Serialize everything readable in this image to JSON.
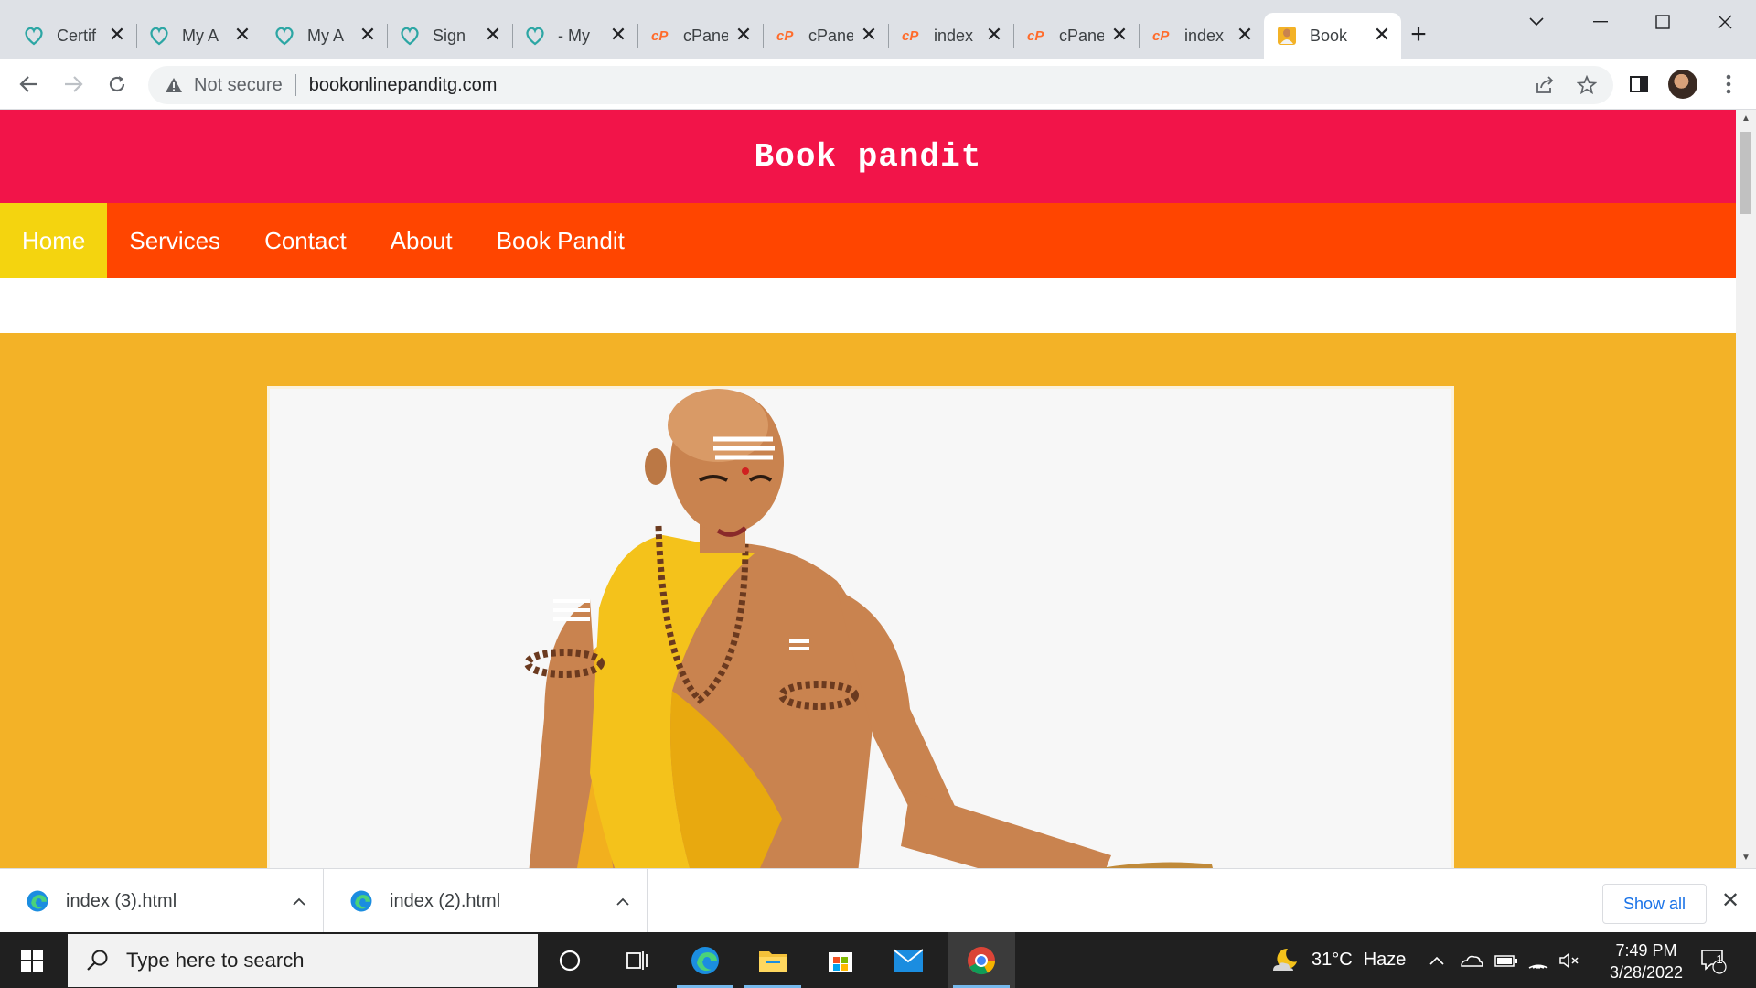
{
  "browser": {
    "tabs": [
      {
        "title": "Certif",
        "icon": "heart-logo-icon",
        "active": false
      },
      {
        "title": "My A",
        "icon": "heart-logo-icon",
        "active": false
      },
      {
        "title": "My A",
        "icon": "heart-logo-icon",
        "active": false
      },
      {
        "title": "Sign",
        "icon": "heart-logo-icon",
        "active": false
      },
      {
        "title": "- My",
        "icon": "heart-logo-icon",
        "active": false
      },
      {
        "title": "cPane",
        "icon": "cpanel-icon",
        "active": false
      },
      {
        "title": "cPane",
        "icon": "cpanel-icon",
        "active": false
      },
      {
        "title": "index",
        "icon": "cpanel-icon",
        "active": false
      },
      {
        "title": "cPane",
        "icon": "cpanel-icon",
        "active": false
      },
      {
        "title": "index",
        "icon": "cpanel-icon",
        "active": false
      },
      {
        "title": "Book",
        "icon": "site-favicon",
        "active": true
      }
    ],
    "close_glyph": "✕",
    "newtab_glyph": "+",
    "security_label": "Not secure",
    "url": "bookonlinepanditg.com",
    "colors": {
      "tabstrip": "#dee1e6",
      "toolbar": "#ffffff",
      "omnibox": "#f1f3f4"
    }
  },
  "site": {
    "title": "Book pandit",
    "nav": [
      {
        "label": "Home",
        "active": true
      },
      {
        "label": "Services",
        "active": false
      },
      {
        "label": "Contact",
        "active": false
      },
      {
        "label": "About",
        "active": false
      },
      {
        "label": "Book Pandit",
        "active": false
      }
    ],
    "hero_image": "pandit-illustration",
    "colors": {
      "header": "#f21449",
      "nav": "#ff4500",
      "nav_active": "#f4d40f",
      "hero": "#f3b227"
    }
  },
  "downloads": {
    "items": [
      {
        "name": "index (3).html",
        "icon": "edge-icon"
      },
      {
        "name": "index (2).html",
        "icon": "edge-icon"
      }
    ],
    "chevron": "^",
    "show_all": "Show all",
    "close_glyph": "✕"
  },
  "taskbar": {
    "search_placeholder": "Type here to search",
    "weather": {
      "temp": "31°C",
      "condition": "Haze"
    },
    "time": "7:49 PM",
    "date": "3/28/2022",
    "notification_count": "1",
    "apps": [
      "cortana-icon",
      "task-view-icon",
      "edge-icon",
      "file-explorer-icon",
      "store-icon",
      "mail-icon",
      "chrome-icon"
    ]
  }
}
